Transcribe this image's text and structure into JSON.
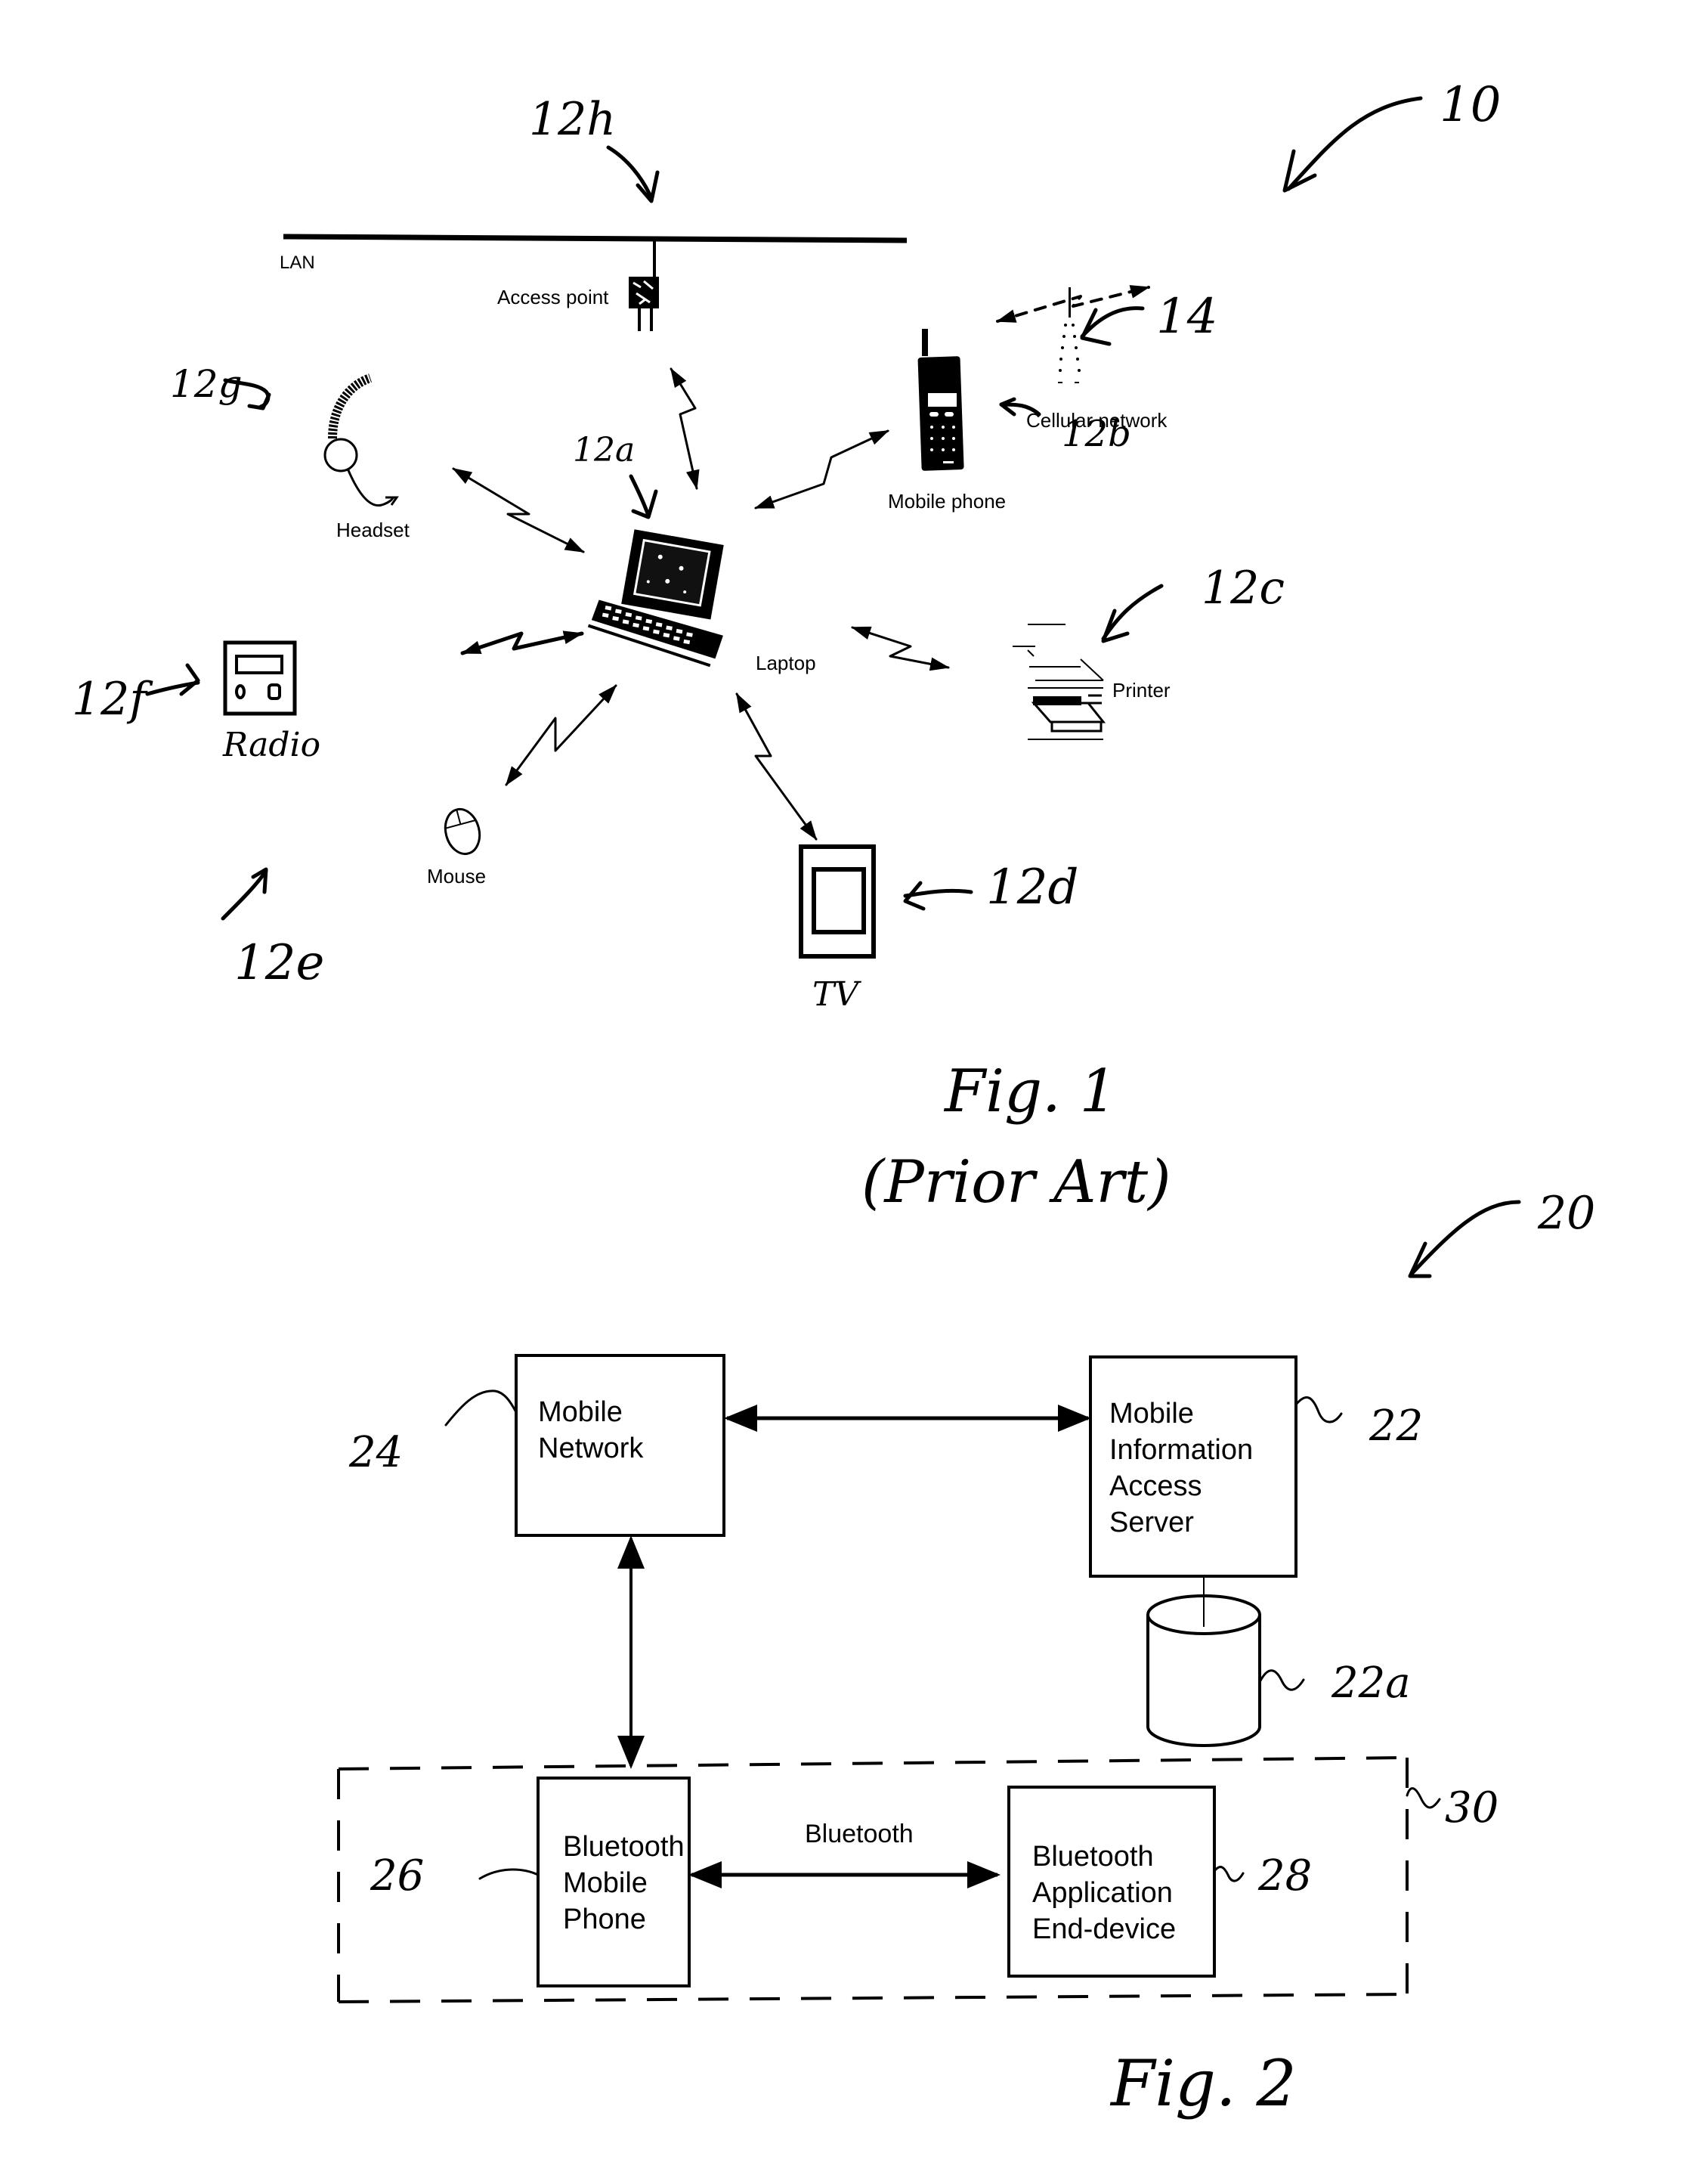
{
  "fig1": {
    "caption": "Fig. 1",
    "caption_sub": "(Prior Art)",
    "system_ref": "10",
    "lan_label": "LAN",
    "lan_ref": "12h",
    "access_point_label": "Access point",
    "devices": [
      {
        "id": "laptop",
        "label": "Laptop",
        "ref": "12a"
      },
      {
        "id": "mobile-phone",
        "label": "Mobile phone",
        "ref": "12b"
      },
      {
        "id": "printer",
        "label": "Printer",
        "ref": "12c"
      },
      {
        "id": "tv",
        "label": "TV",
        "ref": "12d"
      },
      {
        "id": "mouse",
        "label": "Mouse",
        "ref": "12e"
      },
      {
        "id": "radio",
        "label": "Radio",
        "ref": "12f"
      },
      {
        "id": "headset",
        "label": "Headset",
        "ref": "12g"
      }
    ],
    "cellular": {
      "label": "Cellular network",
      "ref": "14"
    }
  },
  "fig2": {
    "caption": "Fig. 2",
    "system_ref": "20",
    "boxes": {
      "mobile_network": {
        "lines": [
          "Mobile",
          "Network"
        ],
        "ref": "24"
      },
      "server": {
        "lines": [
          "Mobile",
          "Information",
          "Access",
          "Server"
        ],
        "ref": "22"
      },
      "database": {
        "ref": "22a"
      },
      "bt_phone": {
        "lines": [
          "Bluetooth",
          "Mobile",
          "Phone"
        ],
        "ref": "26"
      },
      "bt_device": {
        "lines": [
          "Bluetooth",
          "Application",
          "End-device"
        ],
        "ref": "28"
      }
    },
    "link_label": "Bluetooth",
    "group_ref": "30"
  }
}
